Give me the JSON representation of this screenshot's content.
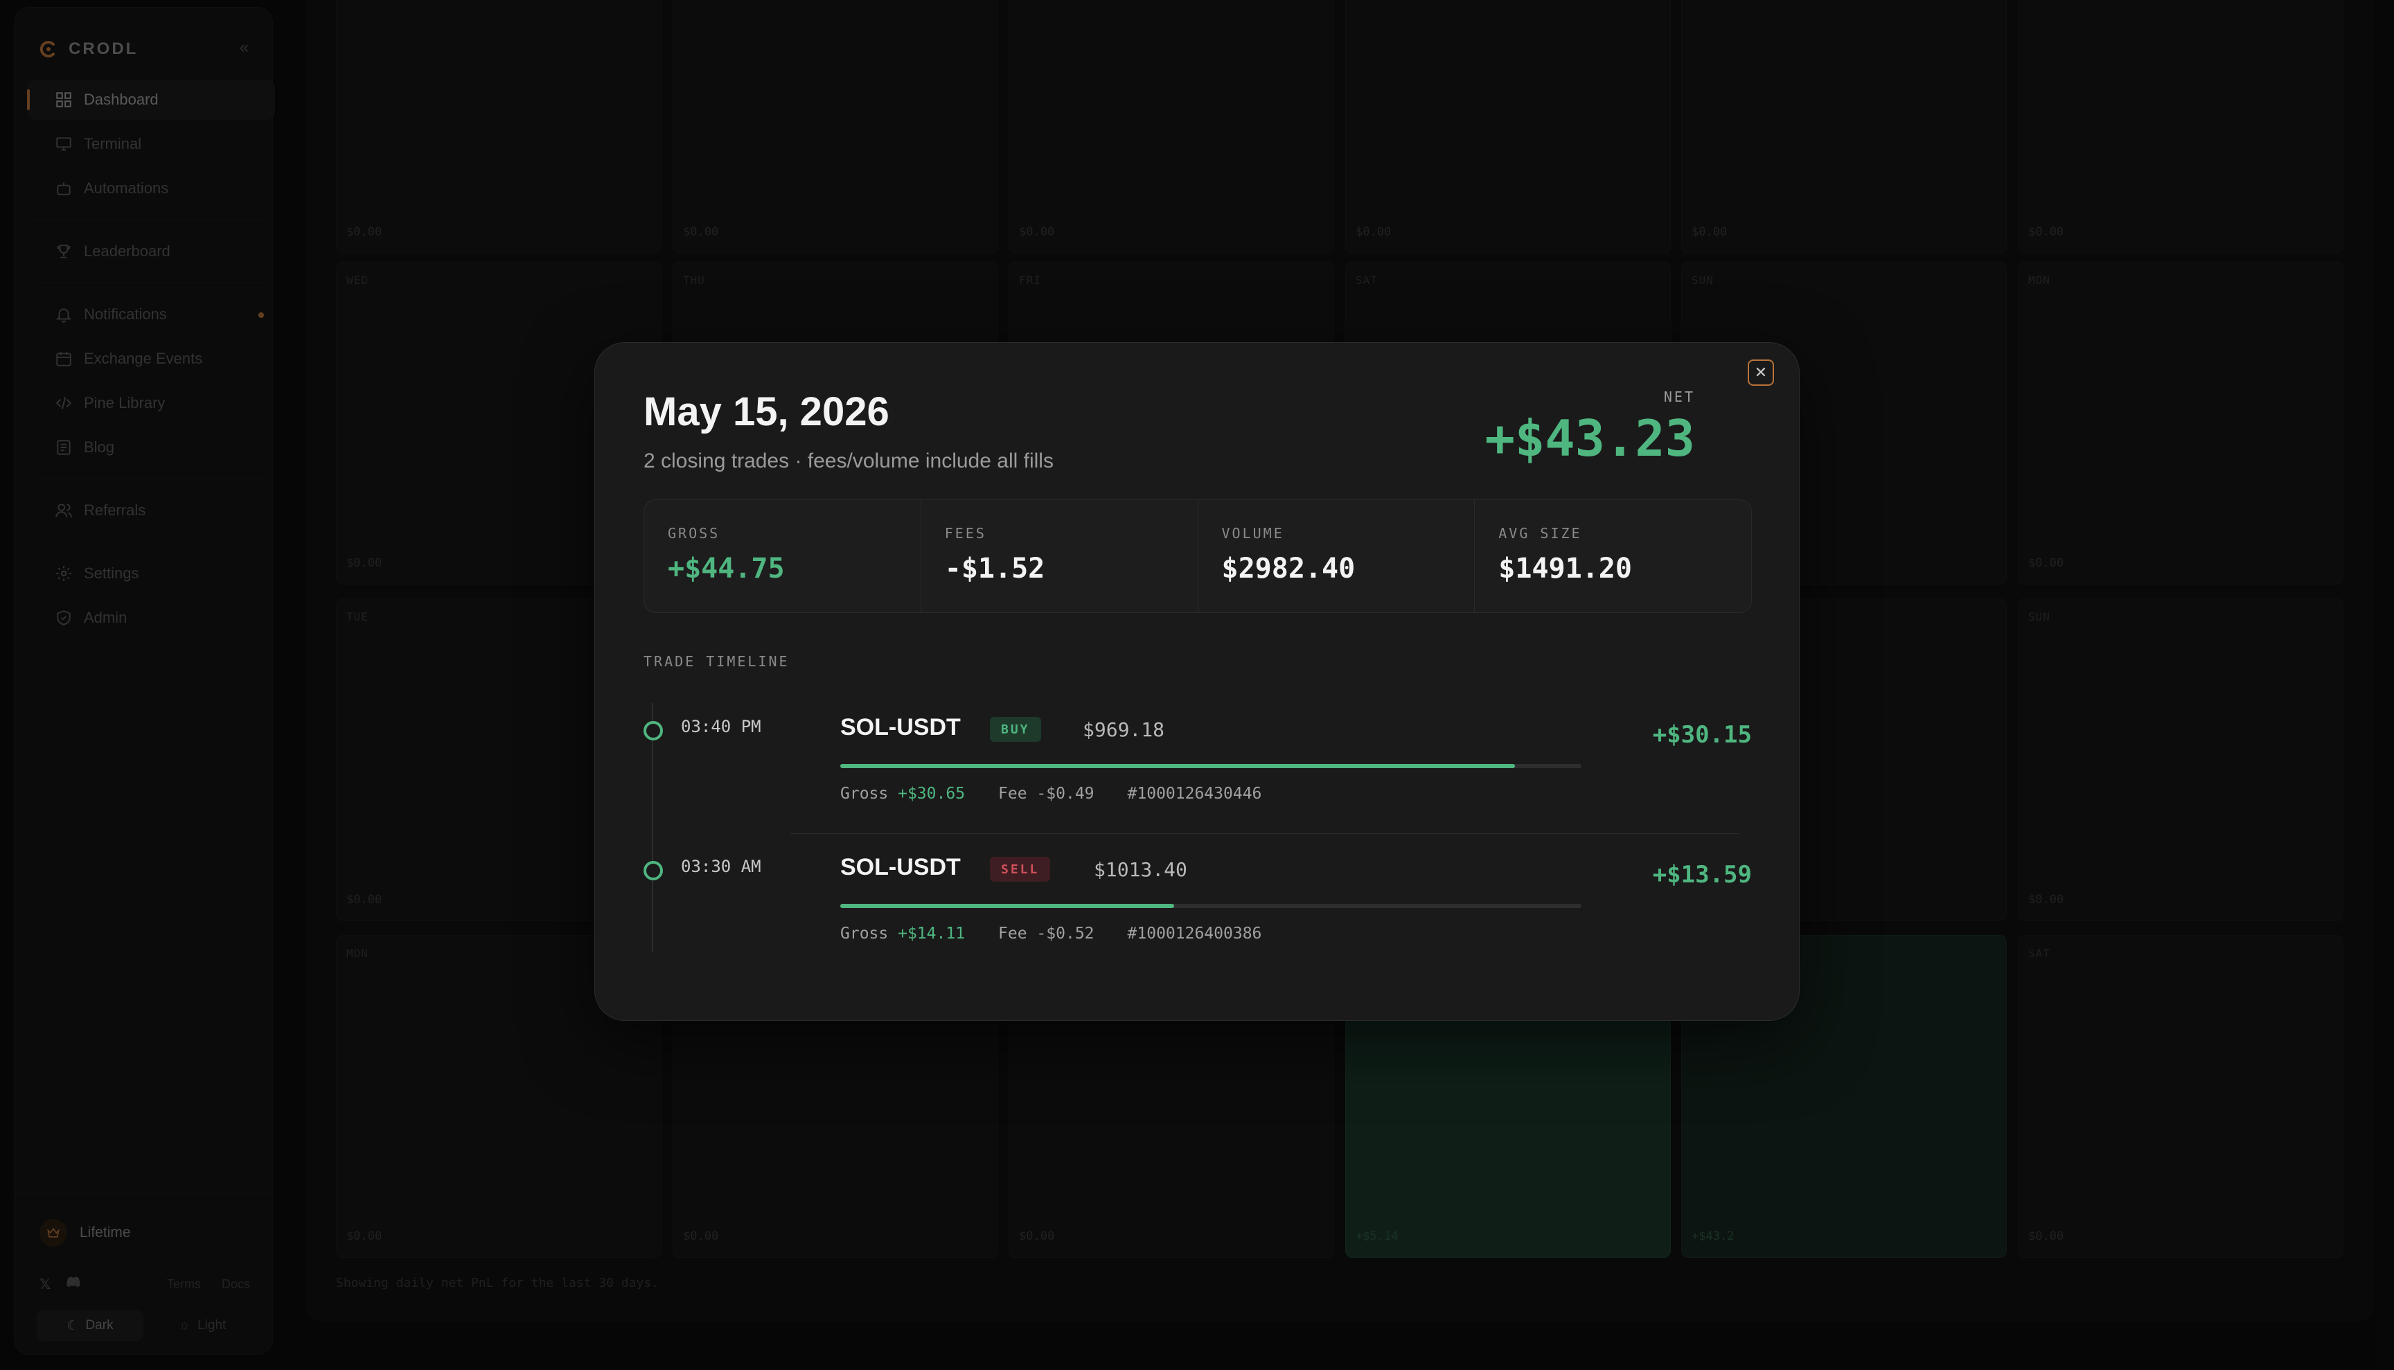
{
  "app": {
    "name": "CRODL"
  },
  "sidebar": {
    "items": [
      {
        "label": "Dashboard",
        "icon": "dashboard-icon"
      },
      {
        "label": "Terminal",
        "icon": "monitor-icon"
      },
      {
        "label": "Automations",
        "icon": "bot-icon"
      },
      {
        "label": "Leaderboard",
        "icon": "trophy-icon"
      },
      {
        "label": "Notifications",
        "icon": "bell-icon"
      },
      {
        "label": "Exchange Events",
        "icon": "calendar-icon"
      },
      {
        "label": "Pine Library",
        "icon": "code-icon"
      },
      {
        "label": "Blog",
        "icon": "newspaper-icon"
      },
      {
        "label": "Referrals",
        "icon": "users-icon"
      },
      {
        "label": "Settings",
        "icon": "gear-icon"
      },
      {
        "label": "Admin",
        "icon": "shield-icon"
      }
    ],
    "plan_label": "Lifetime",
    "links": {
      "terms": "Terms",
      "docs": "Docs"
    },
    "theme": {
      "dark": "Dark",
      "light": "Light"
    }
  },
  "calendar": {
    "note": "Showing daily net PnL for the last 30 days.",
    "row0_values": [
      "$0.00",
      "$0.00",
      "$0.00",
      "$0.00",
      "$0.00",
      "$0.00"
    ],
    "row1": [
      {
        "day": "WED",
        "val": "$0.00"
      },
      {
        "day": "THU",
        "val": ""
      },
      {
        "day": "FRI",
        "val": ""
      },
      {
        "day": "SAT",
        "val": ""
      },
      {
        "day": "SUN",
        "val": ""
      },
      {
        "day": "MON",
        "val": "$0.00"
      }
    ],
    "row2": [
      {
        "day": "TUE",
        "val": "$0.00"
      },
      {
        "day": "",
        "val": ""
      },
      {
        "day": "",
        "val": ""
      },
      {
        "day": "",
        "val": ""
      },
      {
        "day": "",
        "val": ""
      },
      {
        "day": "SUN",
        "val": "$0.00"
      }
    ],
    "row3": [
      {
        "day": "MON",
        "val": "$0.00"
      },
      {
        "day": "",
        "val": "$0.00"
      },
      {
        "day": "",
        "val": "$0.00"
      },
      {
        "day": "",
        "val": "+$5.14"
      },
      {
        "day": "",
        "val": "+$43.2"
      },
      {
        "day": "SAT",
        "val": "$0.00"
      }
    ]
  },
  "modal": {
    "title": "May 15, 2026",
    "subtitle": "2 closing trades · fees/volume include all fills",
    "net_label": "NET",
    "net_value": "+$43.23",
    "stats": [
      {
        "label": "GROSS",
        "value": "+$44.75"
      },
      {
        "label": "FEES",
        "value": "-$1.52"
      },
      {
        "label": "VOLUME",
        "value": "$2982.40"
      },
      {
        "label": "AVG SIZE",
        "value": "$1491.20"
      }
    ],
    "timeline_label": "TRADE TIMELINE",
    "trades": [
      {
        "time": "03:40 PM",
        "pair": "SOL-USDT",
        "side": "BUY",
        "price": "$969.18",
        "progress": 0.91,
        "gross_label": "Gross",
        "gross": "+$30.65",
        "fee": "Fee -$0.49",
        "id": "#1000126430446",
        "pnl": "+$30.15"
      },
      {
        "time": "03:30 AM",
        "pair": "SOL-USDT",
        "side": "SELL",
        "price": "$1013.40",
        "progress": 0.45,
        "gross_label": "Gross",
        "gross": "+$14.11",
        "fee": "Fee -$0.52",
        "id": "#1000126400386",
        "pnl": "+$13.59"
      }
    ]
  },
  "colors": {
    "accent": "#b8743a",
    "positive": "#4fb680",
    "negative": "#d0505c"
  }
}
